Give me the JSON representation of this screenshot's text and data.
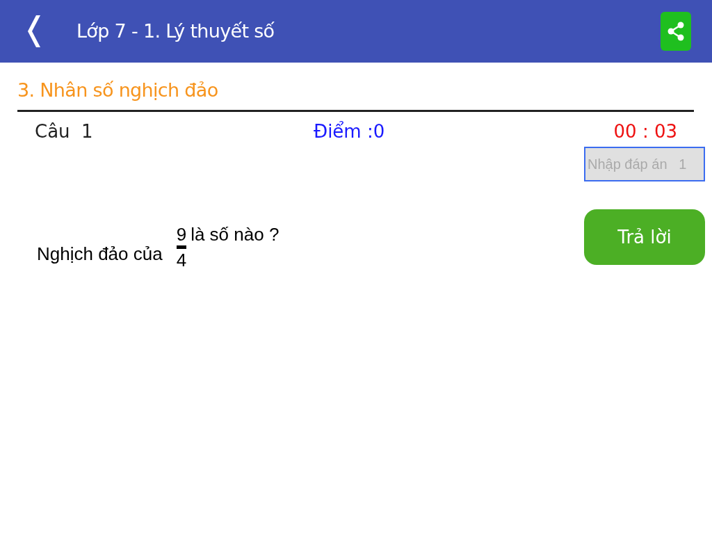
{
  "header": {
    "title": "Lớp 7 - 1. Lý thuyết số"
  },
  "section_title": "3. Nhân số nghịch đảo",
  "status": {
    "question_label": "Câu  1",
    "score": "Điểm :0",
    "timer": "00 : 03"
  },
  "answer_field": {
    "placeholder": "Nhập đáp án   1"
  },
  "question": {
    "before": "Nghịch đảo của",
    "numerator": "9",
    "denominator": "4",
    "after": "là số nào ?"
  },
  "submit_button": "Trả lời"
}
